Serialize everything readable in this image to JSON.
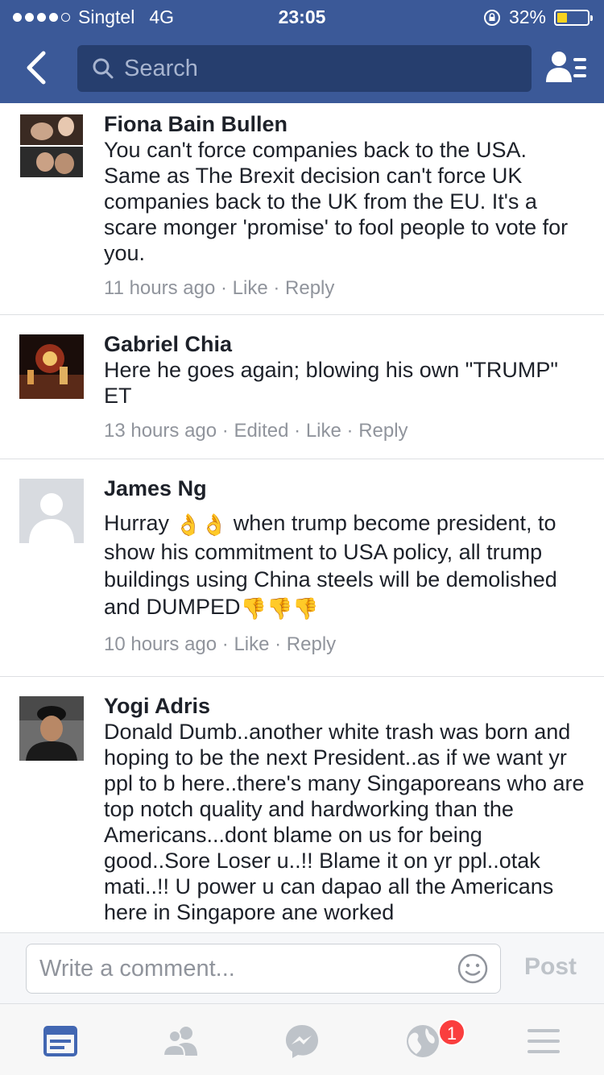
{
  "status_bar": {
    "carrier": "Singtel",
    "network": "4G",
    "time": "23:05",
    "battery_percent": "32%",
    "battery_level": 0.32
  },
  "nav": {
    "search_placeholder": "Search"
  },
  "comments": [
    {
      "name": "Fiona Bain Bullen",
      "text": "You can't force companies back to the USA. Same as The Brexit decision can't force UK companies back to the UK from the EU. It's a scare monger 'promise' to fool people to vote for you.",
      "time": "11 hours ago",
      "like": "Like",
      "reply": "Reply"
    },
    {
      "name": "Gabriel Chia",
      "text": "Here he goes again; blowing his own \"TRUMP\" ET",
      "time": "13 hours ago",
      "edited": "Edited",
      "like": "Like",
      "reply": "Reply"
    },
    {
      "name": "James Ng",
      "text_a": "Hurray",
      "text_b": "when trump become president, to show his commitment to USA policy, all trump buildings using China steels will be demolished and DUMPED",
      "time": "10 hours ago",
      "like": "Like",
      "reply": "Reply"
    },
    {
      "name": "Yogi Adris",
      "text": "Donald Dumb..another white trash was born and hoping to be the next President..as if we want yr ppl to b here..there's many Singaporeans who are top notch quality and hardworking than the Americans...dont blame on us for being good..Sore Loser u..!! Blame it on yr ppl..otak mati..!! U power u can dapao all the Americans here in Singapore ane worked"
    }
  ],
  "meta_separator": " · ",
  "composer": {
    "placeholder": "Write a comment...",
    "post_label": "Post"
  },
  "tabbar": {
    "notifications_badge": "1",
    "active_tab": "news-feed"
  },
  "colors": {
    "brand_blue": "#3b5998",
    "search_bg": "#263e6e",
    "badge_red": "#fa3e3e",
    "meta_gray": "#90949c",
    "active_tab": "#4267b2"
  }
}
